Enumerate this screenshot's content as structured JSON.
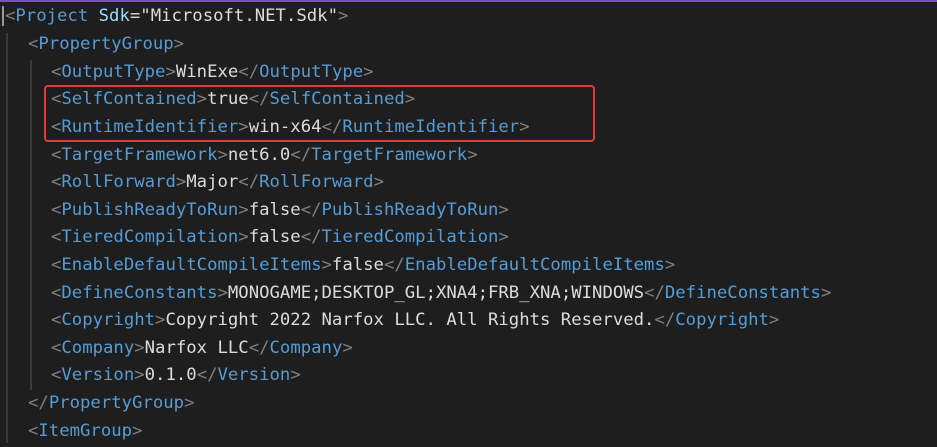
{
  "editor": {
    "project": {
      "tag": "Project",
      "attr_name": "Sdk",
      "attr_value": "Microsoft.NET.Sdk"
    },
    "property_group_tag": "PropertyGroup",
    "properties": [
      {
        "tag": "OutputType",
        "value": "WinExe"
      },
      {
        "tag": "SelfContained",
        "value": "true"
      },
      {
        "tag": "RuntimeIdentifier",
        "value": "win-x64"
      },
      {
        "tag": "TargetFramework",
        "value": "net6.0"
      },
      {
        "tag": "RollForward",
        "value": "Major"
      },
      {
        "tag": "PublishReadyToRun",
        "value": "false"
      },
      {
        "tag": "TieredCompilation",
        "value": "false"
      },
      {
        "tag": "EnableDefaultCompileItems",
        "value": "false"
      },
      {
        "tag": "DefineConstants",
        "value": "MONOGAME;DESKTOP_GL;XNA4;FRB_XNA;WINDOWS"
      },
      {
        "tag": "Copyright",
        "value": "Copyright 2022 Narfox LLC. All Rights Reserved."
      },
      {
        "tag": "Company",
        "value": "Narfox LLC"
      },
      {
        "tag": "Version",
        "value": "0.1.0"
      }
    ],
    "item_group_tag": "ItemGroup",
    "highlight_color": "#e03c3c",
    "tag_color": "#569cd6",
    "attribute_color": "#9cdcfe",
    "bracket_color": "#808080",
    "background_color": "#1e1e1e"
  }
}
